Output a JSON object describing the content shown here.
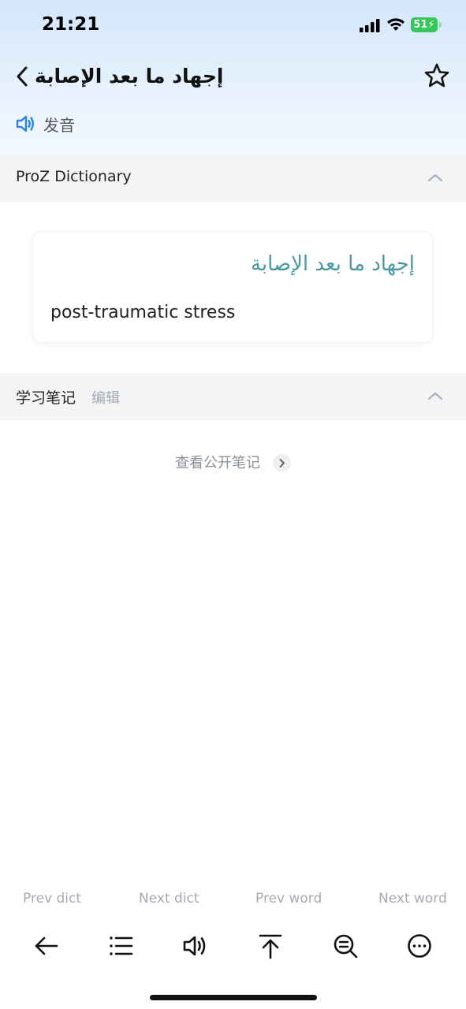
{
  "status_bar": {
    "time": "21:21",
    "battery": "51"
  },
  "header": {
    "word": "إجهاد ما بعد الإصابة",
    "pronunciation_label": "发音"
  },
  "dictionary_section": {
    "title": "ProZ Dictionary",
    "entry": {
      "source": "إجهاد ما بعد الإصابة",
      "translation": "post-traumatic stress"
    }
  },
  "notes_section": {
    "title": "学习笔记",
    "edit_label": "编辑",
    "public_notes_link": "查看公开笔记"
  },
  "bottom_nav": {
    "prev_dict": "Prev dict",
    "next_dict": "Next dict",
    "prev_word": "Prev word",
    "next_word": "Next word"
  },
  "toolbar": {
    "icons": [
      "back-arrow-icon",
      "list-icon",
      "speaker-icon",
      "scroll-top-icon",
      "search-in-page-icon",
      "more-icon"
    ]
  },
  "colors": {
    "accent_arabic": "#4a9aa3",
    "speaker_blue": "#2a84e0",
    "battery_green": "#34c759"
  }
}
